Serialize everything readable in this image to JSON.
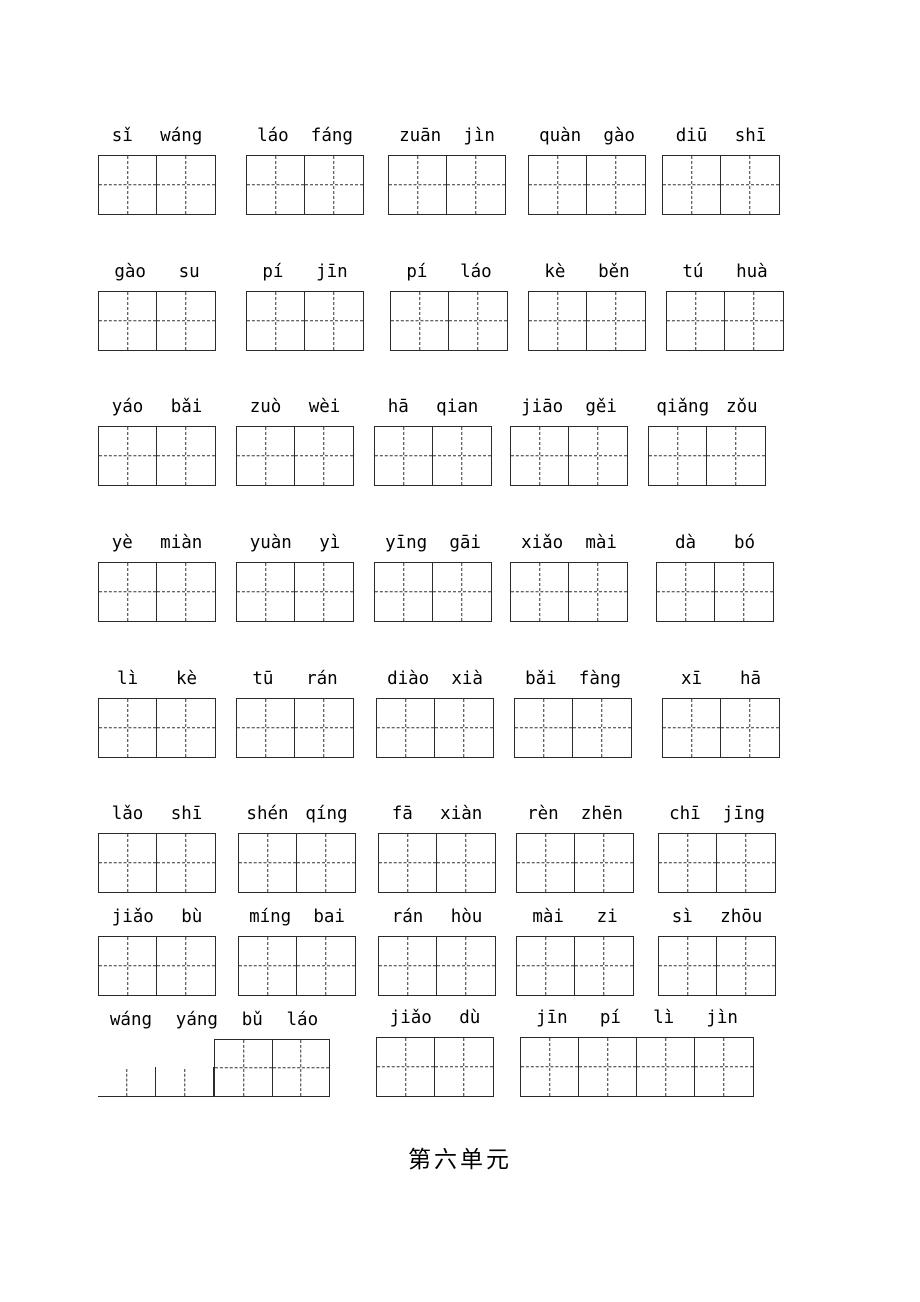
{
  "document": {
    "footer_title": "第六单元",
    "rows": [
      {
        "row_index": 1,
        "entries": [
          {
            "syllables": [
              "sǐ",
              "wáng"
            ],
            "cells": 2
          },
          {
            "syllables": [
              "láo",
              "fáng"
            ],
            "cells": 2
          },
          {
            "syllables": [
              "zuān",
              "jìn"
            ],
            "cells": 2
          },
          {
            "syllables": [
              "quàn",
              "gào"
            ],
            "cells": 2
          },
          {
            "syllables": [
              "diū",
              "shī"
            ],
            "cells": 2
          }
        ]
      },
      {
        "row_index": 2,
        "entries": [
          {
            "syllables": [
              "gào",
              "su"
            ],
            "cells": 2
          },
          {
            "syllables": [
              "pí",
              "jīn"
            ],
            "cells": 2
          },
          {
            "syllables": [
              "pí",
              "láo"
            ],
            "cells": 2
          },
          {
            "syllables": [
              "kè",
              "běn"
            ],
            "cells": 2
          },
          {
            "syllables": [
              "tú",
              "huà"
            ],
            "cells": 2
          }
        ]
      },
      {
        "row_index": 3,
        "entries": [
          {
            "syllables": [
              "yáo",
              "bǎi"
            ],
            "cells": 2
          },
          {
            "syllables": [
              "zuò",
              "wèi"
            ],
            "cells": 2
          },
          {
            "syllables": [
              "hā",
              "qian"
            ],
            "cells": 2
          },
          {
            "syllables": [
              "jiāo",
              "gěi"
            ],
            "cells": 2
          },
          {
            "syllables": [
              "qiǎng",
              "zǒu"
            ],
            "cells": 2
          }
        ]
      },
      {
        "row_index": 4,
        "entries": [
          {
            "syllables": [
              "yè",
              "miàn"
            ],
            "cells": 2
          },
          {
            "syllables": [
              "yuàn",
              "yì"
            ],
            "cells": 2
          },
          {
            "syllables": [
              "yīng",
              "gāi"
            ],
            "cells": 2
          },
          {
            "syllables": [
              "xiǎo",
              "mài"
            ],
            "cells": 2
          },
          {
            "syllables": [
              "dà",
              "bó"
            ],
            "cells": 2
          }
        ]
      },
      {
        "row_index": 5,
        "entries": [
          {
            "syllables": [
              "lì",
              "kè"
            ],
            "cells": 2
          },
          {
            "syllables": [
              "tū",
              "rán"
            ],
            "cells": 2
          },
          {
            "syllables": [
              "diào",
              "xià"
            ],
            "cells": 2
          },
          {
            "syllables": [
              "bǎi",
              "fàng"
            ],
            "cells": 2
          },
          {
            "syllables": [
              "xī",
              "hā"
            ],
            "cells": 2
          }
        ]
      },
      {
        "row_index": 6,
        "entries": [
          {
            "syllables": [
              "lǎo",
              "shī"
            ],
            "cells": 2
          },
          {
            "syllables": [
              "shén",
              "qíng"
            ],
            "cells": 2
          },
          {
            "syllables": [
              "fā",
              "xiàn"
            ],
            "cells": 2
          },
          {
            "syllables": [
              "rèn",
              "zhēn"
            ],
            "cells": 2
          },
          {
            "syllables": [
              "chī",
              "jīng"
            ],
            "cells": 2
          }
        ]
      },
      {
        "row_index": 7,
        "entries": [
          {
            "syllables": [
              "jiǎo",
              "bù"
            ],
            "cells": 2
          },
          {
            "syllables": [
              "míng",
              "bai"
            ],
            "cells": 2
          },
          {
            "syllables": [
              "rán",
              "hòu"
            ],
            "cells": 2
          },
          {
            "syllables": [
              "mài",
              "zi"
            ],
            "cells": 2
          },
          {
            "syllables": [
              "sì",
              "zhōu"
            ],
            "cells": 2
          }
        ]
      },
      {
        "row_index": 8,
        "entries": [
          {
            "syllables": [
              "wáng",
              "yáng",
              "bǔ",
              "láo"
            ],
            "cells": 4,
            "clipped_cells": 2
          },
          {
            "syllables": [
              "jiǎo",
              "dù"
            ],
            "cells": 2
          },
          {
            "syllables": [
              "jīn",
              "pí",
              "lì",
              "jìn"
            ],
            "cells": 4
          }
        ]
      }
    ]
  }
}
